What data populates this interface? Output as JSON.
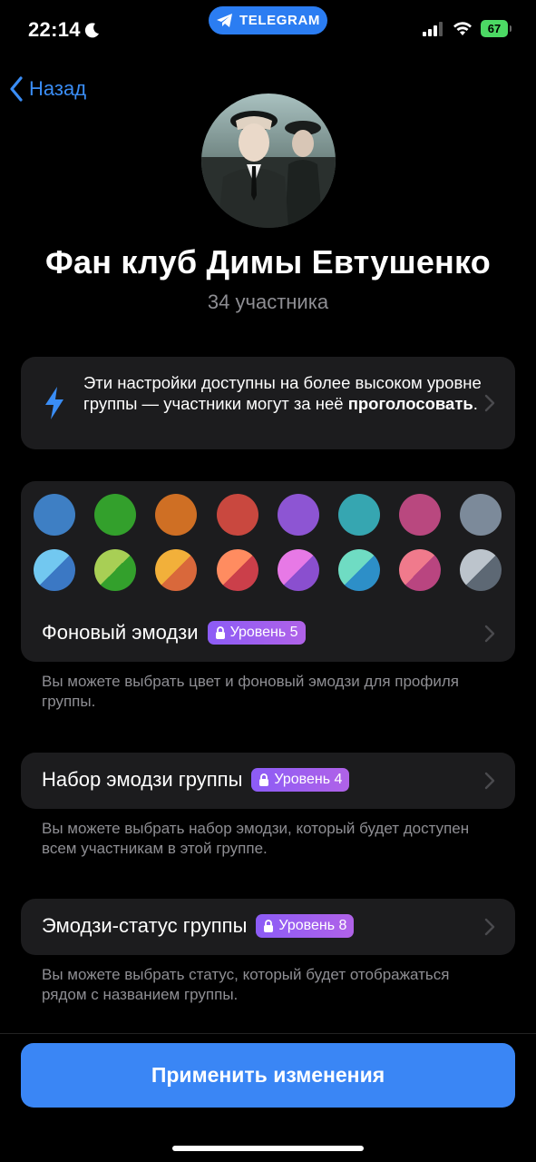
{
  "status_bar": {
    "time": "22:14",
    "app_pill": "TELEGRAM",
    "battery": "67"
  },
  "nav": {
    "back_label": "Назад"
  },
  "group": {
    "name": "Фан клуб Димы Евтушенко",
    "members": "34 участника"
  },
  "info": {
    "text_main": "Эти настройки доступны на более высоком уровне группы — участники могут за неё ",
    "text_bold": "проголосовать",
    "text_end": "."
  },
  "colors": {
    "row1": [
      "#3e7fc4",
      "#33a02c",
      "#cf6f24",
      "#c9483f",
      "#8d55d3",
      "#36a6b1",
      "#b9487f",
      "#7c8a9a"
    ],
    "row2": [
      [
        "#72c8f0",
        "#3b78c4"
      ],
      [
        "#a8cf55",
        "#33a02c"
      ],
      [
        "#f2b03a",
        "#d9683b"
      ],
      [
        "#ff8c60",
        "#cb3f4a"
      ],
      [
        "#e779e6",
        "#8a4fcf"
      ],
      [
        "#6fdcc3",
        "#2d8fc8"
      ],
      [
        "#f07a8c",
        "#b94580"
      ],
      [
        "#bcc4cc",
        "#5d6874"
      ]
    ]
  },
  "background_emoji": {
    "label": "Фоновый эмодзи",
    "badge": "Уровень 5"
  },
  "background_hint": "Вы можете выбрать цвет и фоновый эмодзи для профиля группы.",
  "emoji_pack": {
    "label": "Набор эмодзи группы",
    "badge": "Уровень 4"
  },
  "emoji_pack_hint": "Вы можете выбрать набор эмодзи, который будет доступен всем участникам в этой группе.",
  "emoji_status": {
    "label": "Эмодзи-статус группы",
    "badge": "Уровень 8"
  },
  "emoji_status_hint": "Вы можете выбрать статус, который будет отображаться рядом с названием группы.",
  "apply_button": "Применить изменения",
  "accent": "#3a86f5",
  "badge_color": "#9b5cf6"
}
